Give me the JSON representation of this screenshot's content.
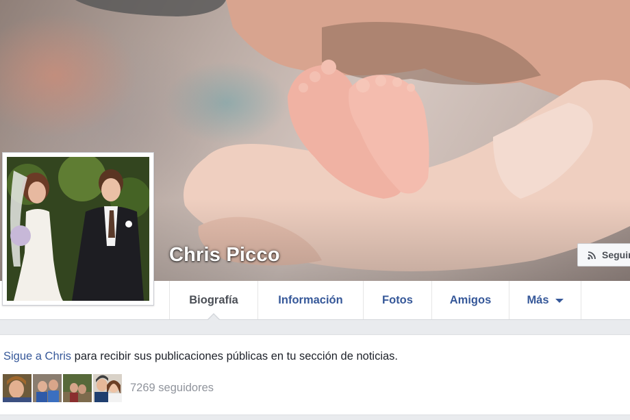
{
  "profile": {
    "name": "Chris Picco"
  },
  "header": {
    "follow_button_label": "Seguir"
  },
  "tabs": [
    {
      "label": "Biografía",
      "active": true
    },
    {
      "label": "Información",
      "active": false
    },
    {
      "label": "Fotos",
      "active": false
    },
    {
      "label": "Amigos",
      "active": false
    },
    {
      "label": "Más",
      "active": false
    }
  ],
  "follow_card": {
    "link_text": "Sigue a Chris",
    "message_text": " para recibir sus publicaciones públicas en tu sección de noticias.",
    "follower_count_text": "7269 seguidores",
    "avatar_count": 4
  },
  "icons": {
    "follow_icon": "rss-feed-icon",
    "more_icon": "caret-down-icon"
  },
  "colors": {
    "link_blue": "#365899",
    "page_background": "#e9ebee"
  }
}
